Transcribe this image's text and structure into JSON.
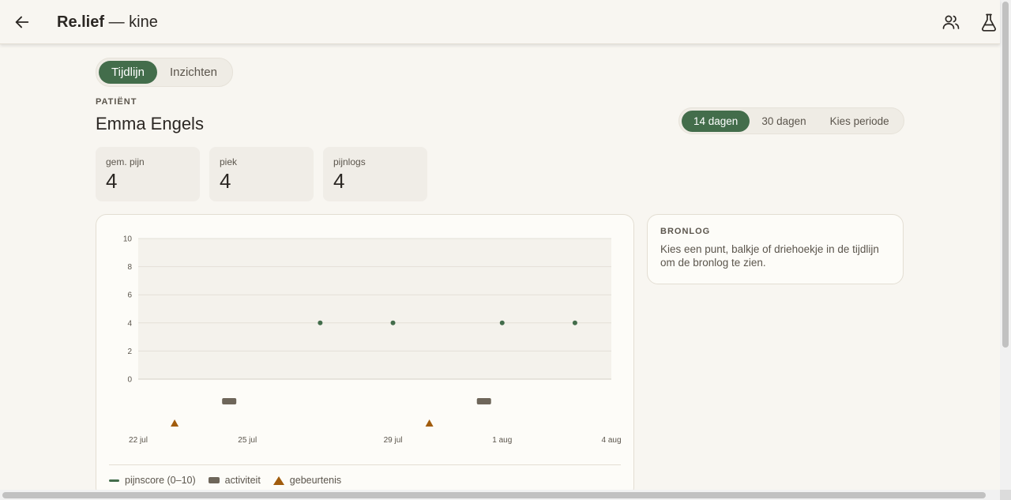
{
  "header": {
    "brand": "Re.lief",
    "subtitle": " — kine",
    "icons": [
      "back-arrow-icon",
      "users-icon",
      "flask-icon"
    ]
  },
  "view_tabs": [
    {
      "label": "Tijdlijn",
      "active": true
    },
    {
      "label": "Inzichten",
      "active": false
    }
  ],
  "patient": {
    "label": "PATIËNT",
    "name": "Emma Engels"
  },
  "period": [
    {
      "label": "14 dagen",
      "active": true
    },
    {
      "label": "30 dagen",
      "active": false
    },
    {
      "label": "Kies periode",
      "active": false
    }
  ],
  "stats": [
    {
      "label": "gem. pijn",
      "value": "4"
    },
    {
      "label": "piek",
      "value": "4"
    },
    {
      "label": "pijnlogs",
      "value": "4"
    }
  ],
  "chart_data": {
    "type": "scatter",
    "title": "",
    "xlabel": "",
    "ylabel": "",
    "y_ticks": [
      "0",
      "2",
      "4",
      "6",
      "8",
      "10"
    ],
    "ylim": [
      0,
      10
    ],
    "x_range": [
      "2024-07-22",
      "2024-08-04"
    ],
    "x_ticks": [
      {
        "date": "2024-07-22",
        "label": "22 jul"
      },
      {
        "date": "2024-07-25",
        "label": "25 jul"
      },
      {
        "date": "2024-07-29",
        "label": "29 jul"
      },
      {
        "date": "2024-08-01",
        "label": "1 aug"
      },
      {
        "date": "2024-08-04",
        "label": "4 aug"
      }
    ],
    "series": [
      {
        "name": "pijnscore (0–10)",
        "kind": "point",
        "color": "#436d4b",
        "points": [
          {
            "date": "2024-07-27",
            "value": 4
          },
          {
            "date": "2024-07-29",
            "value": 4
          },
          {
            "date": "2024-08-01",
            "value": 4
          },
          {
            "date": "2024-08-03",
            "value": 4
          }
        ]
      },
      {
        "name": "activiteit",
        "kind": "bar",
        "color": "#6e665a",
        "dates": [
          "2024-07-24",
          "2024-07-31"
        ]
      },
      {
        "name": "gebeurtenis",
        "kind": "triangle",
        "color": "#a15c0d",
        "dates": [
          "2024-07-23",
          "2024-07-30"
        ]
      }
    ],
    "grid": true,
    "legend_position": "bottom"
  },
  "legend": [
    {
      "label": "pijnscore (0–10)"
    },
    {
      "label": "activiteit"
    },
    {
      "label": "gebeurtenis"
    }
  ],
  "source_log": {
    "title": "BRONLOG",
    "body": "Kies een punt, balkje of driehoekje in de tijdlijn om de bronlog te zien."
  }
}
